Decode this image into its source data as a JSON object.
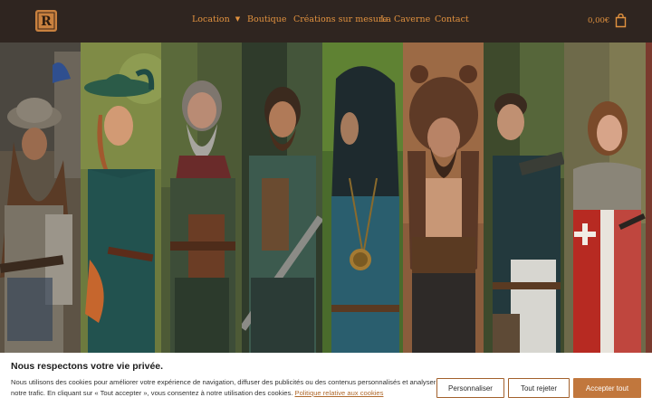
{
  "header": {
    "logo_text": "R",
    "nav": [
      {
        "label": "Location",
        "has_dropdown": true
      },
      {
        "label": "Boutique"
      },
      {
        "label": "Créations sur mesure"
      },
      {
        "label": "La Caverne"
      },
      {
        "label": "Contact"
      }
    ],
    "cart_total": "0,00€",
    "cart_icon": "shopping-bag-icon"
  },
  "cookie": {
    "title": "Nous respectons votre vie privée.",
    "text": "Nous utilisons des cookies pour améliorer votre expérience de navigation, diffuser des publicités ou des contenus personnalisés et analyser notre trafic. En cliquant sur « Tout accepter », vous consentez à notre utilisation des cookies.",
    "policy_link": "Politique relative aux cookies",
    "buttons": {
      "customize": "Personnaliser",
      "reject": "Tout rejeter",
      "accept": "Accepter tout"
    }
  },
  "colors": {
    "header_bg": "#2f2520",
    "accent": "#e2923f",
    "button_accent": "#c1773d"
  }
}
